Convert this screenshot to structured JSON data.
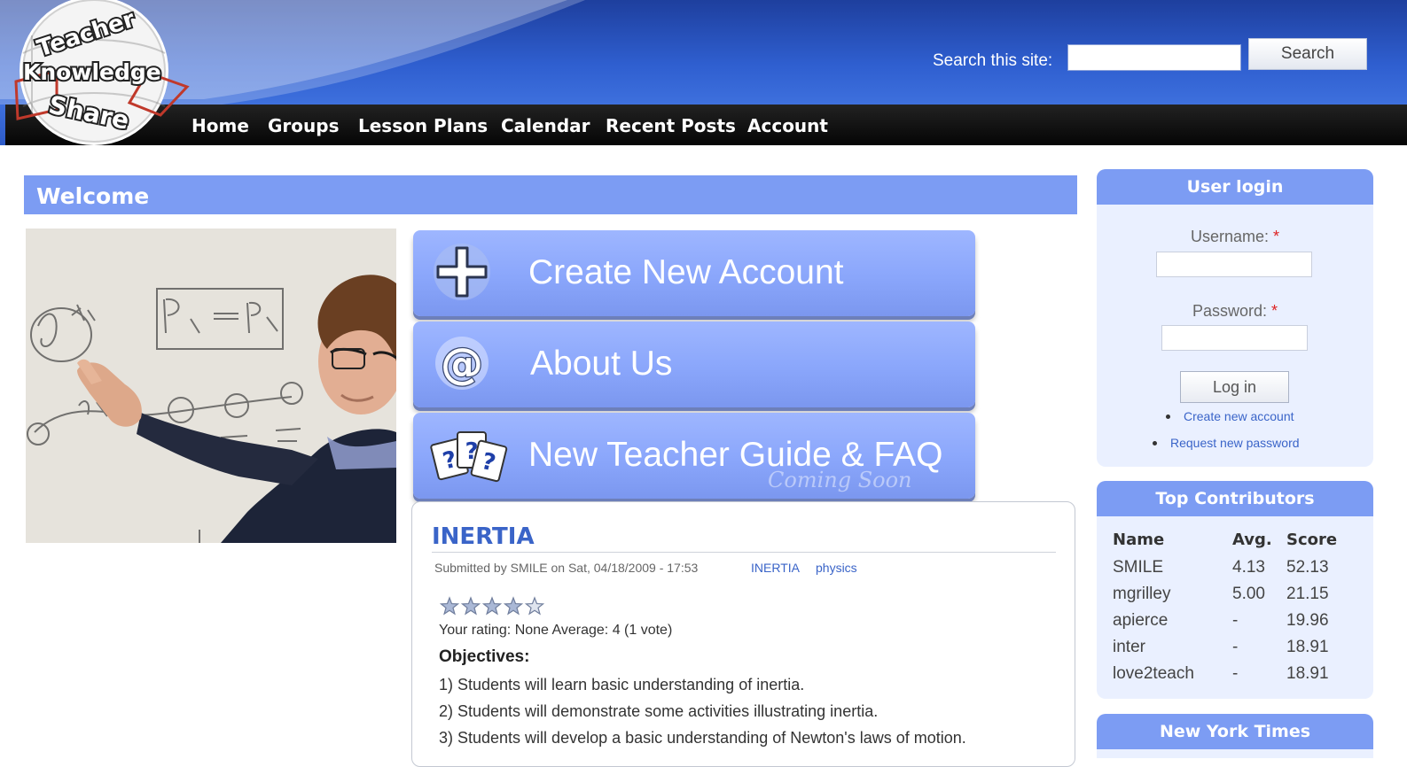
{
  "logo": {
    "line1": "Teacher",
    "line2": "Knowledge",
    "line3": "Share"
  },
  "header": {
    "search_label": "Search this site:",
    "search_value": "",
    "search_button": "Search",
    "nav": [
      "Home",
      "Groups",
      "Lesson Plans",
      "Calendar",
      "Recent Posts",
      "Account"
    ]
  },
  "welcome": {
    "title": "Welcome"
  },
  "actions": [
    {
      "label": "Create New Account",
      "icon": "plus-icon"
    },
    {
      "label": "About Us",
      "icon": "at-sign-icon"
    },
    {
      "label": "New Teacher Guide & FAQ",
      "icon": "question-cards-icon",
      "sublabel": "Coming Soon"
    }
  ],
  "node": {
    "title": "INERTIA",
    "submitted": "Submitted by SMILE on Sat, 04/18/2009 - 17:53",
    "tags": [
      "INERTIA",
      "physics"
    ],
    "rating_text": "Your rating: None Average: 4 (1 vote)",
    "rating_stars": 4,
    "objectives_heading": "Objectives:",
    "objectives": [
      "1) Students will learn basic understanding of inertia.",
      "2) Students will demonstrate some activities illustrating inertia.",
      "3) Students will develop a basic understanding of Newton's laws of motion."
    ]
  },
  "login": {
    "title": "User login",
    "username_label": "Username:",
    "password_label": "Password:",
    "required_mark": "*",
    "button": "Log in",
    "links": [
      "Create new account",
      "Request new password"
    ]
  },
  "contributors": {
    "title": "Top Contributors",
    "headers": [
      "Name",
      "Avg.",
      "Score"
    ],
    "rows": [
      [
        "SMILE",
        "4.13",
        "52.13"
      ],
      [
        "mgrilley",
        "5.00",
        "21.15"
      ],
      [
        "apierce",
        "-",
        "19.96"
      ],
      [
        "inter",
        "-",
        "18.91"
      ],
      [
        "love2teach",
        "-",
        "18.91"
      ]
    ]
  },
  "nyt": {
    "title": "New York Times"
  },
  "colors": {
    "header_blue": "#2f5fd0",
    "accent": "#7c9cf3",
    "link": "#3a64c8",
    "nav_bg": "#0a0a0a"
  }
}
